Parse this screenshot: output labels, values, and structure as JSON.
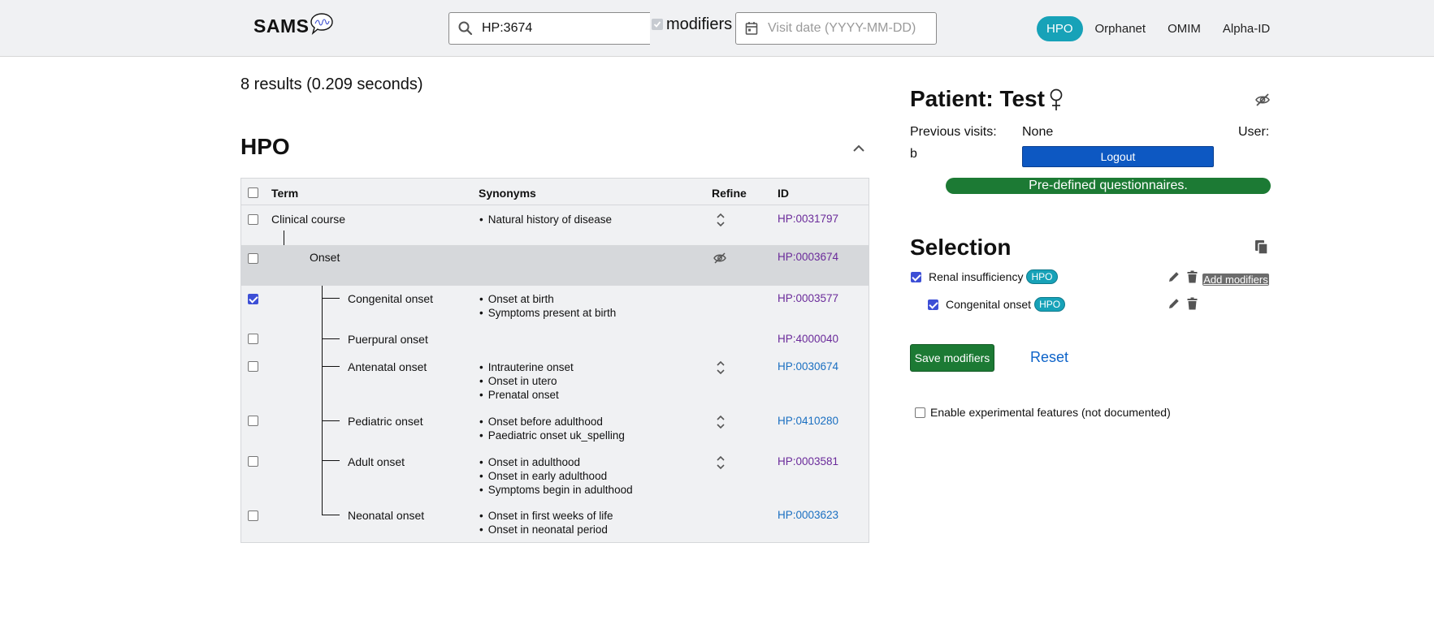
{
  "header": {
    "logo_text": "SAMS",
    "search_value": "HP:3674",
    "modifiers_label": "modifiers",
    "modifiers_checked": true,
    "date_placeholder": "Visit date (YYYY-MM-DD)",
    "tabs": [
      {
        "label": "HPO",
        "active": true
      },
      {
        "label": "Orphanet",
        "active": false
      },
      {
        "label": "OMIM",
        "active": false
      },
      {
        "label": "Alpha-ID",
        "active": false
      }
    ]
  },
  "results": {
    "count_text": "8 results (0.209 seconds)",
    "section_title": "HPO",
    "columns": [
      "Term",
      "Synonyms",
      "Refine",
      "ID"
    ],
    "rows": [
      {
        "term": "Clinical course",
        "depth": 0,
        "checked": false,
        "synonyms": [
          "Natural history of disease"
        ],
        "refine": "expand",
        "id": "HP:0031797",
        "id_style": "visited",
        "highlight": false
      },
      {
        "term": "Onset",
        "depth": 1,
        "checked": false,
        "synonyms": [],
        "refine": "hidden",
        "id": "HP:0003674",
        "id_style": "visited",
        "highlight": true
      },
      {
        "term": "Congenital onset",
        "depth": 2,
        "checked": true,
        "synonyms": [
          "Onset at birth",
          "Symptoms present at birth"
        ],
        "refine": "none",
        "id": "HP:0003577",
        "id_style": "visited",
        "highlight": false
      },
      {
        "term": "Puerpural onset",
        "depth": 2,
        "checked": false,
        "synonyms": [],
        "refine": "none",
        "id": "HP:4000040",
        "id_style": "visited",
        "highlight": false
      },
      {
        "term": "Antenatal onset",
        "depth": 2,
        "checked": false,
        "synonyms": [
          "Intrauterine onset",
          "Onset in utero",
          "Prenatal onset"
        ],
        "refine": "expand",
        "id": "HP:0030674",
        "id_style": "link",
        "highlight": false
      },
      {
        "term": "Pediatric onset",
        "depth": 2,
        "checked": false,
        "synonyms": [
          "Onset before adulthood",
          "Paediatric onset uk_spelling"
        ],
        "refine": "expand",
        "id": "HP:0410280",
        "id_style": "link",
        "highlight": false
      },
      {
        "term": "Adult onset",
        "depth": 2,
        "checked": false,
        "synonyms": [
          "Onset in adulthood",
          "Onset in early adulthood",
          "Symptoms begin in adulthood"
        ],
        "refine": "expand",
        "id": "HP:0003581",
        "id_style": "visited",
        "highlight": false
      },
      {
        "term": "Neonatal onset",
        "depth": 2,
        "checked": false,
        "synonyms": [
          "Onset in first weeks of life",
          "Onset in neonatal period"
        ],
        "refine": "none",
        "id": "HP:0003623",
        "id_style": "link",
        "highlight": false
      }
    ]
  },
  "patient": {
    "title": "Patient: Test",
    "previous_visits_label": "Previous visits:",
    "previous_visits_value": "None",
    "user_label": "User:",
    "user_value": "b",
    "logout_label": "Logout",
    "questionnaires_label": "Pre-defined questionnaires."
  },
  "selection": {
    "title": "Selection",
    "items": [
      {
        "label": "Renal insufficiency",
        "badge": "HPO",
        "checked": true
      },
      {
        "label": "Congenital onset",
        "badge": "HPO",
        "checked": true
      }
    ],
    "add_modifiers_label": "Add modifiers",
    "save_label": "Save modifiers",
    "reset_label": "Reset",
    "experimental_label": "Enable experimental features (not documented)"
  },
  "colors": {
    "accent": "#17a2b8",
    "logout": "#0d58c2",
    "success": "#1c7a34",
    "visited_link": "#6a2a9a",
    "link": "#1a6fc1"
  }
}
